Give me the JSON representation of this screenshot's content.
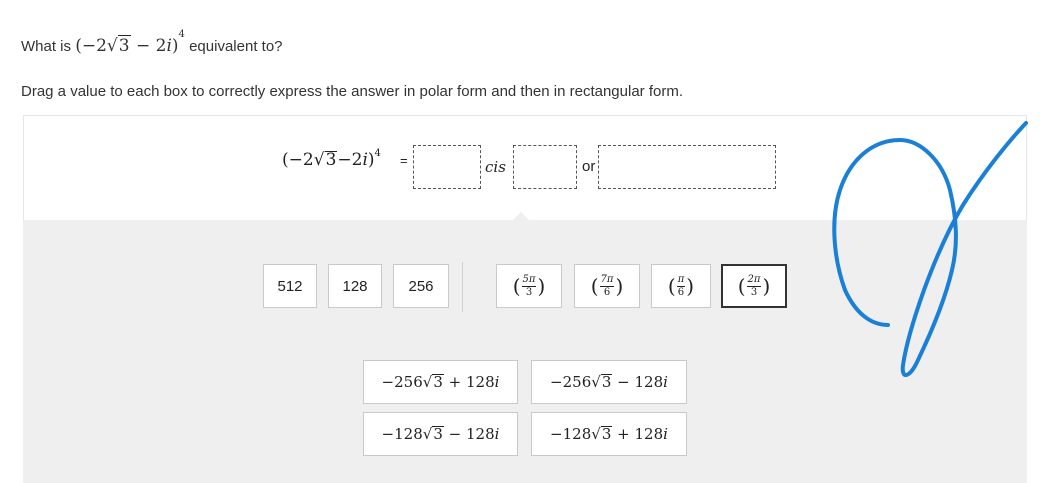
{
  "question": {
    "prefix": "What is",
    "coef": "2",
    "radicand": "3",
    "i_coef": "2",
    "i": "i",
    "power": "4",
    "suffix": "equivalent to?"
  },
  "instruction": "Drag a value to each box to correctly express the answer in polar form and then in rectangular form.",
  "answer_row": {
    "equals": "=",
    "cis": "cis",
    "or": "or"
  },
  "magnitude_tiles": [
    "512",
    "128",
    "256"
  ],
  "angle_tiles": [
    {
      "num": "5π",
      "den": "3"
    },
    {
      "num": "7π",
      "den": "6"
    },
    {
      "num": "π",
      "den": "6"
    },
    {
      "num": "2π",
      "den": "3"
    }
  ],
  "rect_tiles": [
    {
      "sign": "−",
      "coef": "256",
      "rad": "3",
      "op": "+",
      "im": "128",
      "i": "i"
    },
    {
      "sign": "−",
      "coef": "256",
      "rad": "3",
      "op": "−",
      "im": "128",
      "i": "i"
    },
    {
      "sign": "−",
      "coef": "128",
      "rad": "3",
      "op": "−",
      "im": "128",
      "i": "i"
    },
    {
      "sign": "−",
      "coef": "128",
      "rad": "3",
      "op": "+",
      "im": "128",
      "i": "i"
    }
  ],
  "colors": {
    "panel": "#efefef",
    "scribble": "#1a7fd6"
  }
}
